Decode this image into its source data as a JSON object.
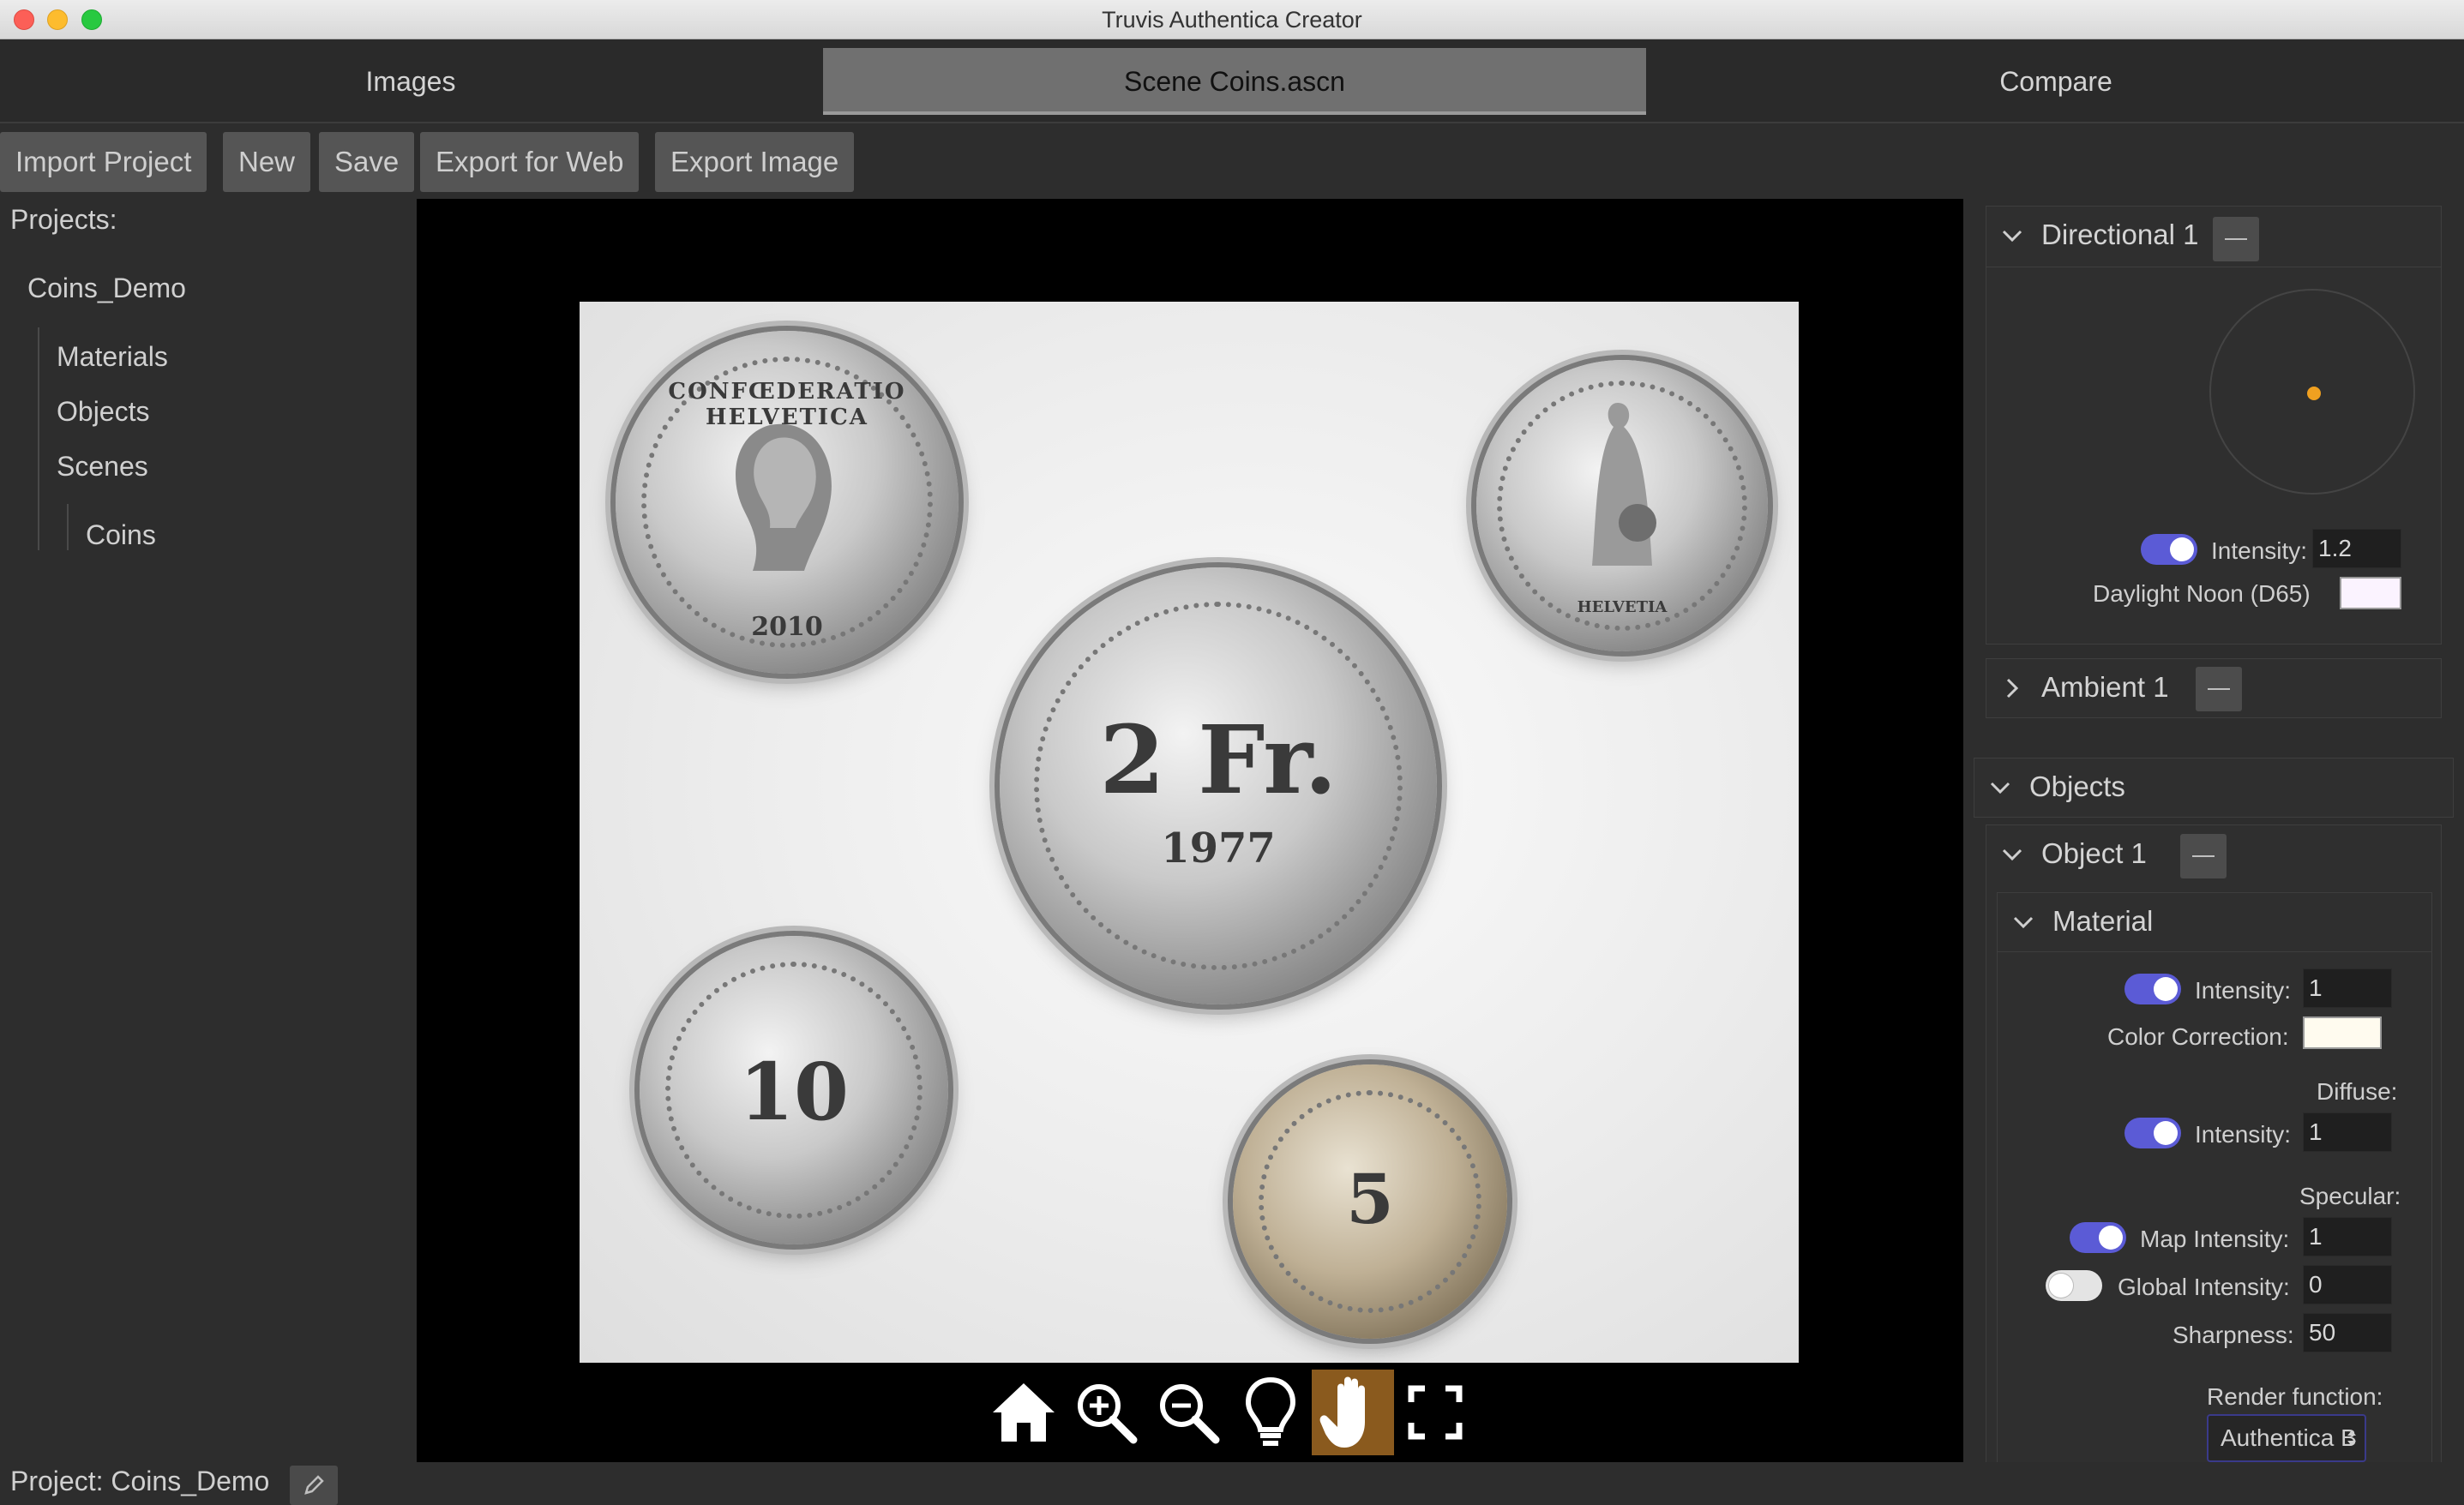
{
  "window": {
    "title": "Truvis Authentica Creator"
  },
  "main_tabs": [
    {
      "label": "Images"
    },
    {
      "label": "Scene Coins.ascn"
    },
    {
      "label": "Compare"
    }
  ],
  "toolbar": {
    "import_label": "Import Project",
    "new_label": "New",
    "save_label": "Save",
    "export_web_label": "Export for Web",
    "export_image_label": "Export Image"
  },
  "projects": {
    "heading": "Projects:",
    "name": "Coins_Demo",
    "items": [
      "Materials",
      "Objects",
      "Scenes"
    ],
    "scene": "Coins"
  },
  "coins": {
    "c1_top": "CONFŒDERATIO HELVETICA",
    "c1_year": "2010",
    "c2_value": "2 Fr.",
    "c2_year": "1977",
    "c3_top": "HELVETIA",
    "c4_value": "10",
    "c5_value": "5"
  },
  "view_tools": [
    "home-icon",
    "zoom-in-icon",
    "zoom-out-icon",
    "light-bulb-icon",
    "hand-pan-icon",
    "fullscreen-icon"
  ],
  "lights": {
    "directional": {
      "title": "Directional 1",
      "intensity_label": "Intensity:",
      "intensity_value": "1.2",
      "preset_label": "Daylight Noon (D65)",
      "enabled": true
    },
    "ambient": {
      "title": "Ambient 1"
    }
  },
  "objects": {
    "heading": "Objects",
    "object1": {
      "title": "Object 1",
      "material": {
        "title": "Material",
        "intensity_label": "Intensity:",
        "intensity_value": "1",
        "color_correction_label": "Color Correction:",
        "diffuse_label": "Diffuse:",
        "diffuse_intensity_label": "Intensity:",
        "diffuse_intensity_value": "1",
        "specular_label": "Specular:",
        "map_intensity_label": "Map Intensity:",
        "map_intensity_value": "1",
        "global_intensity_label": "Global Intensity:",
        "global_intensity_value": "0",
        "sharpness_label": "Sharpness:",
        "sharpness_value": "50",
        "render_function_label": "Render function:",
        "render_function_value": "Authentica B"
      }
    }
  },
  "colors": {
    "accent": "#5b5bd6",
    "active_tool": "#8a5a1e",
    "light_dot": "#f0a020"
  },
  "status": {
    "project_label": "Project: Coins_Demo"
  }
}
